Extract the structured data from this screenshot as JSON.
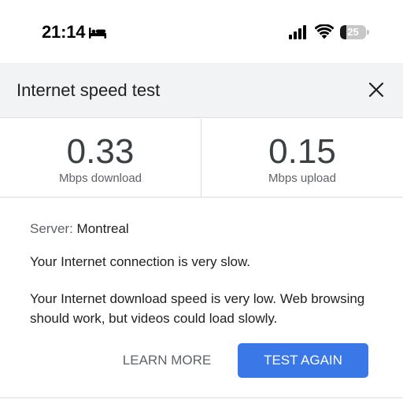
{
  "status_bar": {
    "time": "21:14",
    "battery_level": "25",
    "battery_fraction": 0.25
  },
  "dialog": {
    "title": "Internet speed test"
  },
  "results": {
    "download_value": "0.33",
    "download_unit": "Mbps download",
    "upload_value": "0.15",
    "upload_unit": "Mbps upload"
  },
  "details": {
    "server_label": "Server:",
    "server_value": "Montreal",
    "status_message": "Your Internet connection is very slow.",
    "detail_message": "Your Internet download speed is very low. Web browsing should work, but videos could load slowly."
  },
  "actions": {
    "learn_more_label": "LEARN MORE",
    "test_again_label": "TEST AGAIN"
  },
  "colors": {
    "accent": "#3b78e7",
    "header_bg": "#f1f3f4"
  }
}
